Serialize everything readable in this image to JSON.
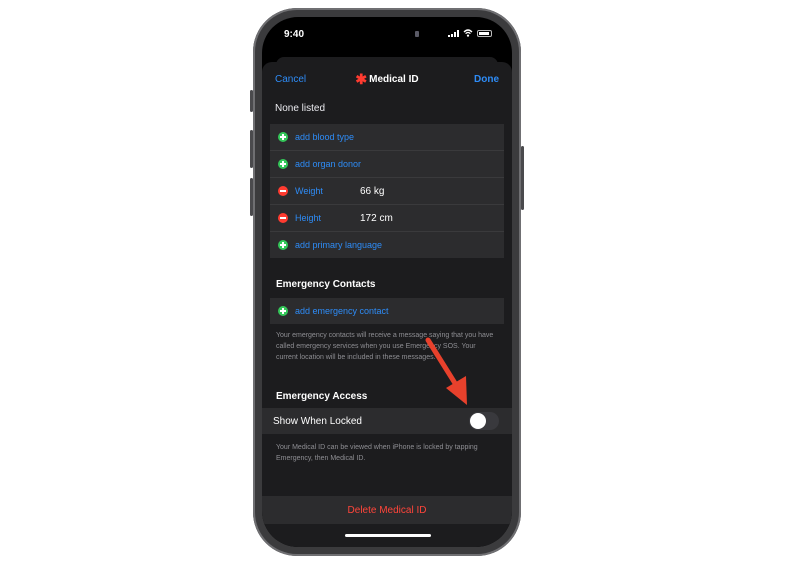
{
  "status_bar": {
    "time": "9:40"
  },
  "nav": {
    "cancel": "Cancel",
    "title": "Medical ID",
    "done": "Done"
  },
  "organ_donor_section": {
    "none_listed": "None listed"
  },
  "fields": [
    {
      "type": "add",
      "label": "add blood type",
      "value": ""
    },
    {
      "type": "add",
      "label": "add organ donor",
      "value": ""
    },
    {
      "type": "remove",
      "label": "Weight",
      "value": "66 kg"
    },
    {
      "type": "remove",
      "label": "Height",
      "value": "172 cm"
    },
    {
      "type": "add",
      "label": "add primary language",
      "value": ""
    }
  ],
  "emergency_contacts": {
    "header": "Emergency Contacts",
    "add_label": "add emergency contact",
    "footnote": "Your emergency contacts will receive a message saying that you have called emergency services when you use Emergency SOS. Your current location will be included in these messages."
  },
  "emergency_access": {
    "header": "Emergency Access",
    "toggle_label": "Show When Locked",
    "toggle_state": "off",
    "footnote": "Your Medical ID can be viewed when iPhone is locked by tapping Emergency, then Medical ID."
  },
  "delete_label": "Delete Medical ID",
  "colors": {
    "accent_blue": "#2e8cf7",
    "add_green": "#34c759",
    "remove_red": "#ff3b30",
    "annotation_arrow": "#e8412c"
  }
}
